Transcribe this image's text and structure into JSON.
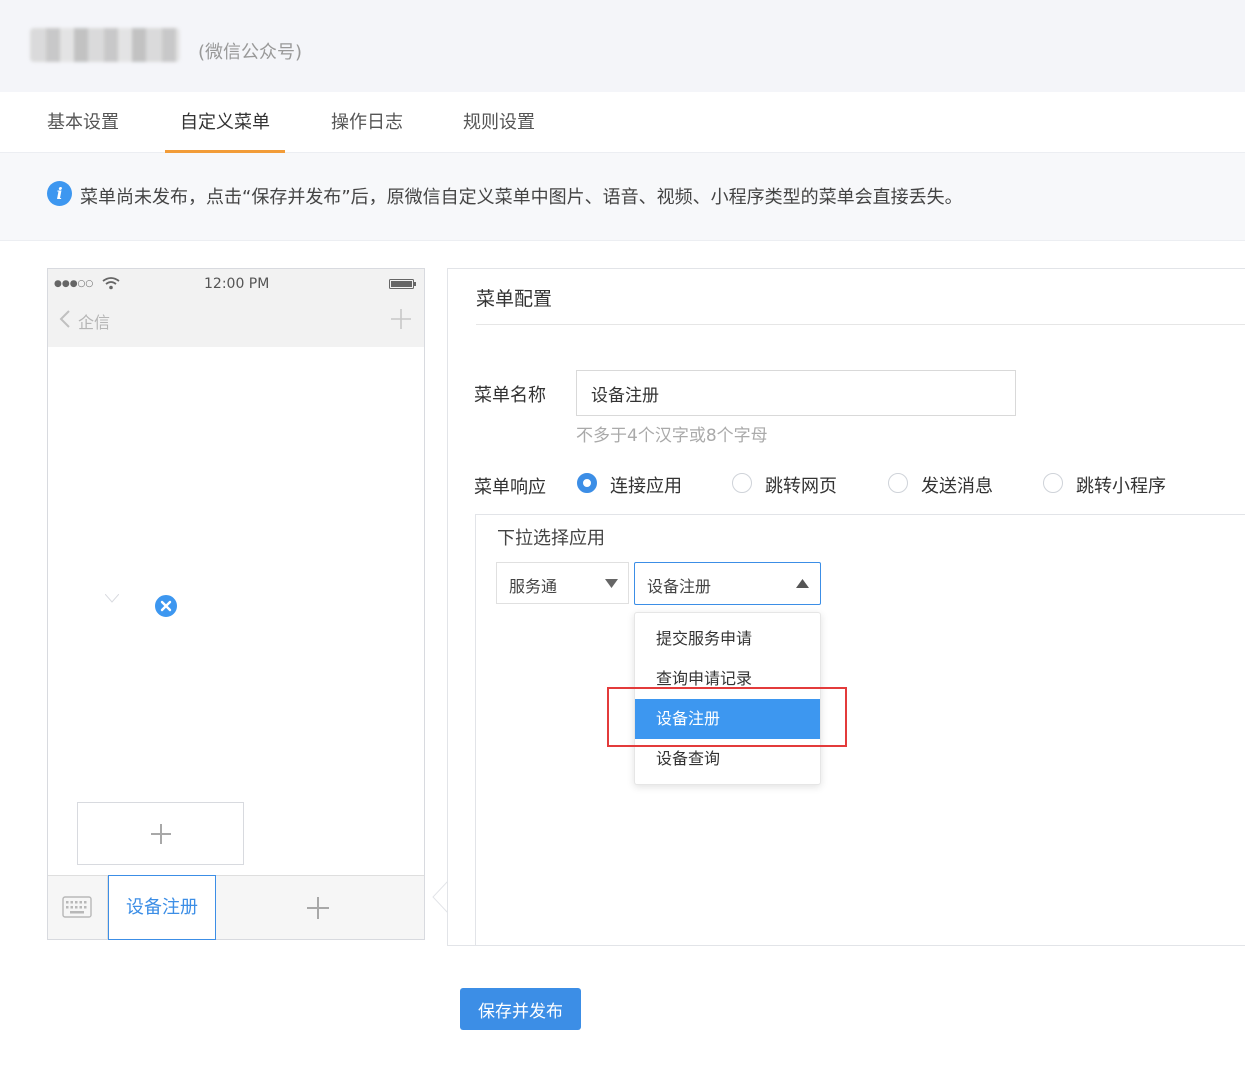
{
  "header": {
    "account_type": "(微信公众号)"
  },
  "tabs": [
    {
      "label": "基本设置",
      "active": false
    },
    {
      "label": "自定义菜单",
      "active": true
    },
    {
      "label": "操作日志",
      "active": false
    },
    {
      "label": "规则设置",
      "active": false
    }
  ],
  "notice": {
    "icon": "info-icon",
    "text": "菜单尚未发布，点击“保存并发布”后，原微信自定义菜单中图片、语音、视频、小程序类型的菜单会直接丢失。"
  },
  "phone": {
    "time": "12:00 PM",
    "back_label": "企信",
    "menu_items": [
      {
        "label": "设备注册",
        "active": true
      }
    ]
  },
  "config": {
    "title": "菜单配置",
    "menu_name_label": "菜单名称",
    "menu_name_value": "设备注册",
    "menu_name_hint": "不多于4个汉字或8个字母",
    "menu_response_label": "菜单响应",
    "response_options": [
      {
        "label": "连接应用",
        "checked": true
      },
      {
        "label": "跳转网页",
        "checked": false
      },
      {
        "label": "发送消息",
        "checked": false
      },
      {
        "label": "跳转小程序",
        "checked": false
      }
    ],
    "dropdown_label": "下拉选择应用",
    "service_select_value": "服务通",
    "app_select_value": "设备注册",
    "app_options": [
      {
        "label": "提交服务申请",
        "selected": false
      },
      {
        "label": "查询申请记录",
        "selected": false
      },
      {
        "label": "设备注册",
        "selected": true
      },
      {
        "label": "设备查询",
        "selected": false
      }
    ]
  },
  "footer": {
    "save_publish_label": "保存并发布"
  },
  "colors": {
    "accent": "#3c8ee6",
    "tab_underline": "#f29c38",
    "highlight": "#e33b3b"
  }
}
